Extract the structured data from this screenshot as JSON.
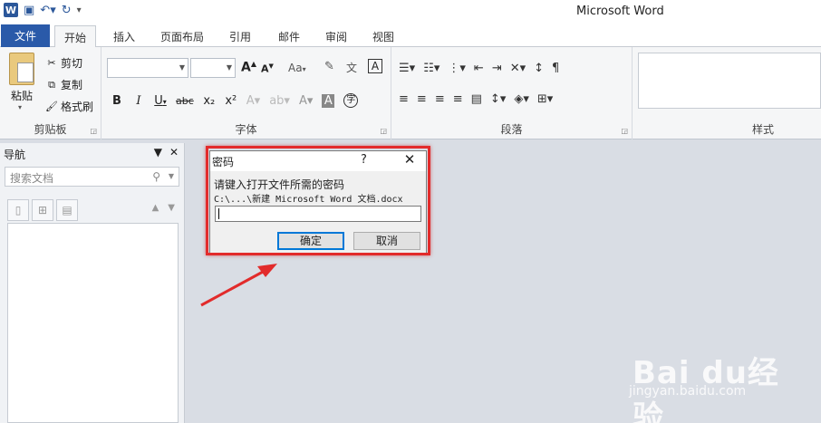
{
  "window": {
    "title": "Microsoft Word"
  },
  "tabs": [
    "文件",
    "开始",
    "插入",
    "页面布局",
    "引用",
    "邮件",
    "审阅",
    "视图"
  ],
  "ribbon": {
    "clipboard": {
      "paste": "粘贴",
      "cut": "剪切",
      "copy": "复制",
      "format_painter": "格式刷",
      "label": "剪贴板"
    },
    "font": {
      "label": "字体",
      "grow_label": "A",
      "shrink_label": "A",
      "case_label": "Aa",
      "bold": "B",
      "italic": "I",
      "underline": "U",
      "strike": "abc",
      "sub": "x₂",
      "sup": "x²"
    },
    "paragraph": {
      "label": "段落"
    },
    "styles": {
      "label": "样式"
    }
  },
  "nav": {
    "title": "导航",
    "search_placeholder": "搜索文档"
  },
  "dialog": {
    "title": "密码",
    "help": "?",
    "close": "✕",
    "prompt": "请键入打开文件所需的密码",
    "path": "C:\\...\\新建 Microsoft Word 文档.docx",
    "ok": "确定",
    "cancel": "取消"
  },
  "watermark": {
    "brand": "Bai du经验",
    "url": "jingyan.baidu.com"
  }
}
